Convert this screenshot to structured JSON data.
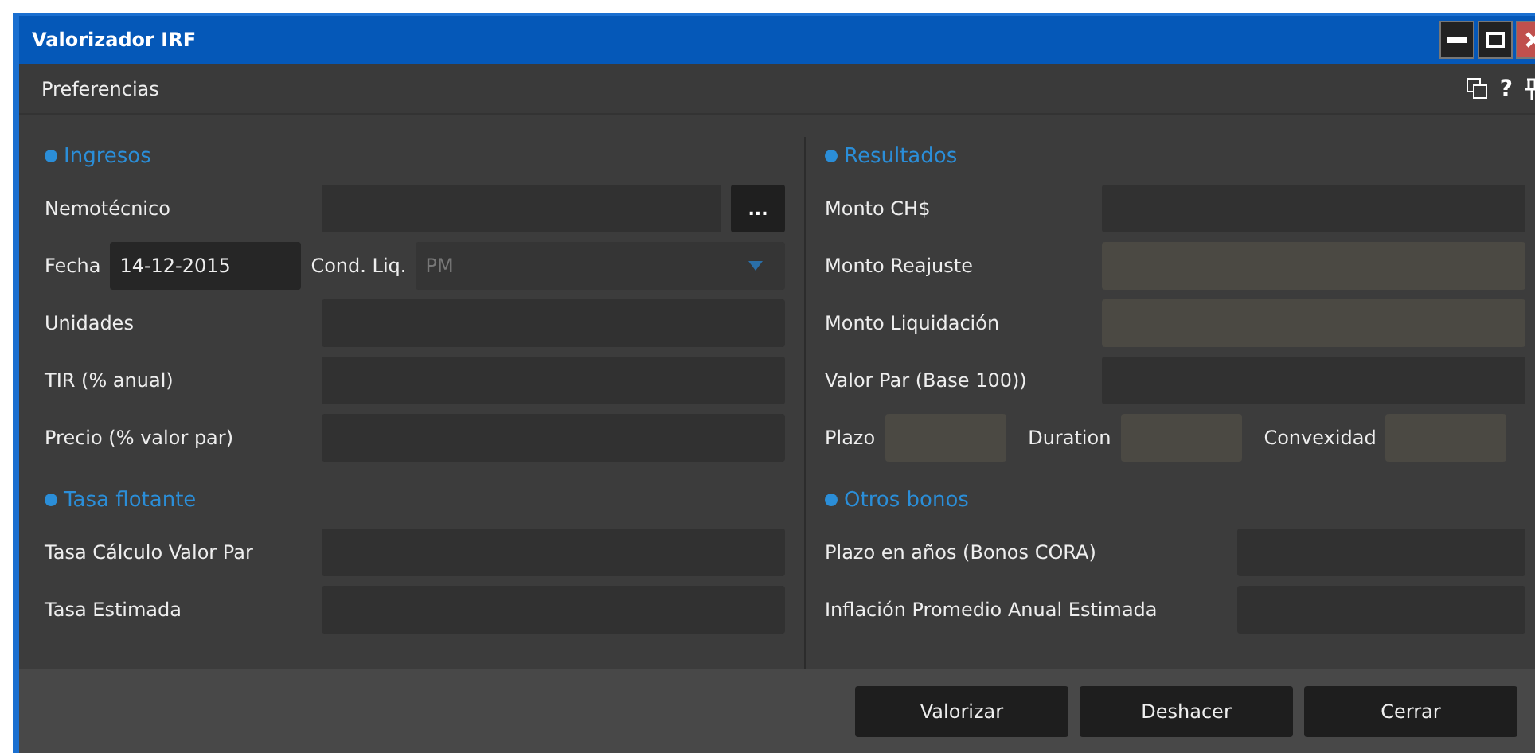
{
  "window": {
    "title": "Valorizador IRF"
  },
  "menu": {
    "items": [
      "Preferencias"
    ],
    "help": "?"
  },
  "ingresos": {
    "title": "Ingresos",
    "nemotecnico": {
      "label": "Nemotécnico",
      "button": "..."
    },
    "fecha": {
      "label": "Fecha",
      "value": "14-12-2015"
    },
    "cond_liq": {
      "label": "Cond. Liq.",
      "value": "PM"
    },
    "fields": [
      {
        "label": "Unidades"
      },
      {
        "label": "TIR (% anual)"
      },
      {
        "label": "Precio (% valor par)"
      }
    ]
  },
  "resultados": {
    "title": "Resultados",
    "fields": [
      {
        "label": "Monto CH$",
        "disabled": false
      },
      {
        "label": "Monto Reajuste",
        "disabled": true
      },
      {
        "label": "Monto Liquidación",
        "disabled": true
      },
      {
        "label": "Valor Par (Base 100))",
        "disabled": false
      }
    ],
    "metrics": [
      {
        "label": "Plazo",
        "disabled": true
      },
      {
        "label": "Duration",
        "disabled": true
      },
      {
        "label": "Convexidad",
        "disabled": true
      }
    ]
  },
  "tasa_flotante": {
    "title": "Tasa flotante",
    "fields": [
      {
        "label": "Tasa Cálculo Valor Par"
      },
      {
        "label": "Tasa Estimada"
      }
    ]
  },
  "otros_bonos": {
    "title": "Otros bonos",
    "fields": [
      {
        "label": "Plazo en años (Bonos CORA)"
      },
      {
        "label": "Inflación Promedio Anual Estimada"
      }
    ]
  },
  "buttons": [
    "Valorizar",
    "Deshacer",
    "Cerrar"
  ]
}
